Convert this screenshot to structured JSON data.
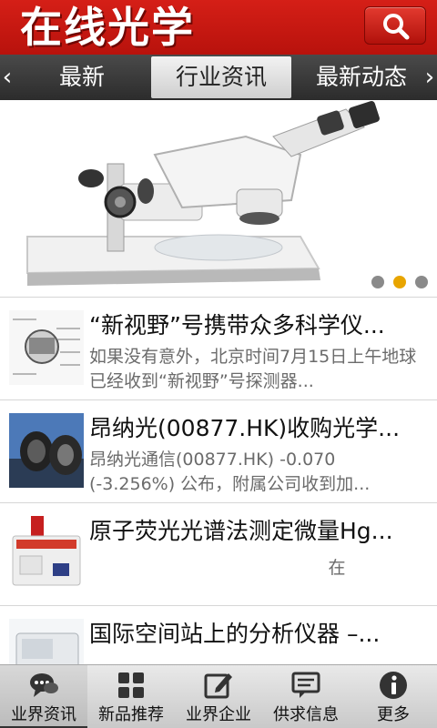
{
  "header": {
    "title": "在线光学",
    "search_icon": "search-icon",
    "brand_color": "#c4160f"
  },
  "nav": {
    "prev_arrow": "‹",
    "next_arrow": "›",
    "tabs": [
      {
        "label": "最新"
      },
      {
        "label": "行业资讯",
        "selected": true
      },
      {
        "label": "最新动态"
      }
    ]
  },
  "banner": {
    "image": "stereo-microscope",
    "slide_count": 3,
    "active_slide": 2,
    "active_dot_color": "#e8a500"
  },
  "news": [
    {
      "title": "“新视野”号携带众多科学仪...",
      "summary": "如果没有意外，北京时间7月15日上午地球已经收到“新视野”号探测器...",
      "thumb": "probe-diagram"
    },
    {
      "title": "昂纳光(00877.HK)收购光学...",
      "summary": "昂纳光通信(00877.HK) -0.070 (-3.256%) 公布，附属公司收到加...",
      "thumb": "optical-lens"
    },
    {
      "title": "原子荧光光谱法测定微量Hg...",
      "summary": "在",
      "thumb": "spectrometer"
    },
    {
      "title": "国际空间站上的分析仪器 –...",
      "summary": "",
      "thumb": "analyzer"
    }
  ],
  "tabbar": {
    "tabs": [
      {
        "label": "业界资讯",
        "icon": "chat-icon",
        "active": true
      },
      {
        "label": "新品推荐",
        "icon": "grid-icon"
      },
      {
        "label": "业界企业",
        "icon": "edit-icon"
      },
      {
        "label": "供求信息",
        "icon": "message-icon"
      },
      {
        "label": "更多",
        "icon": "info-icon"
      }
    ]
  }
}
